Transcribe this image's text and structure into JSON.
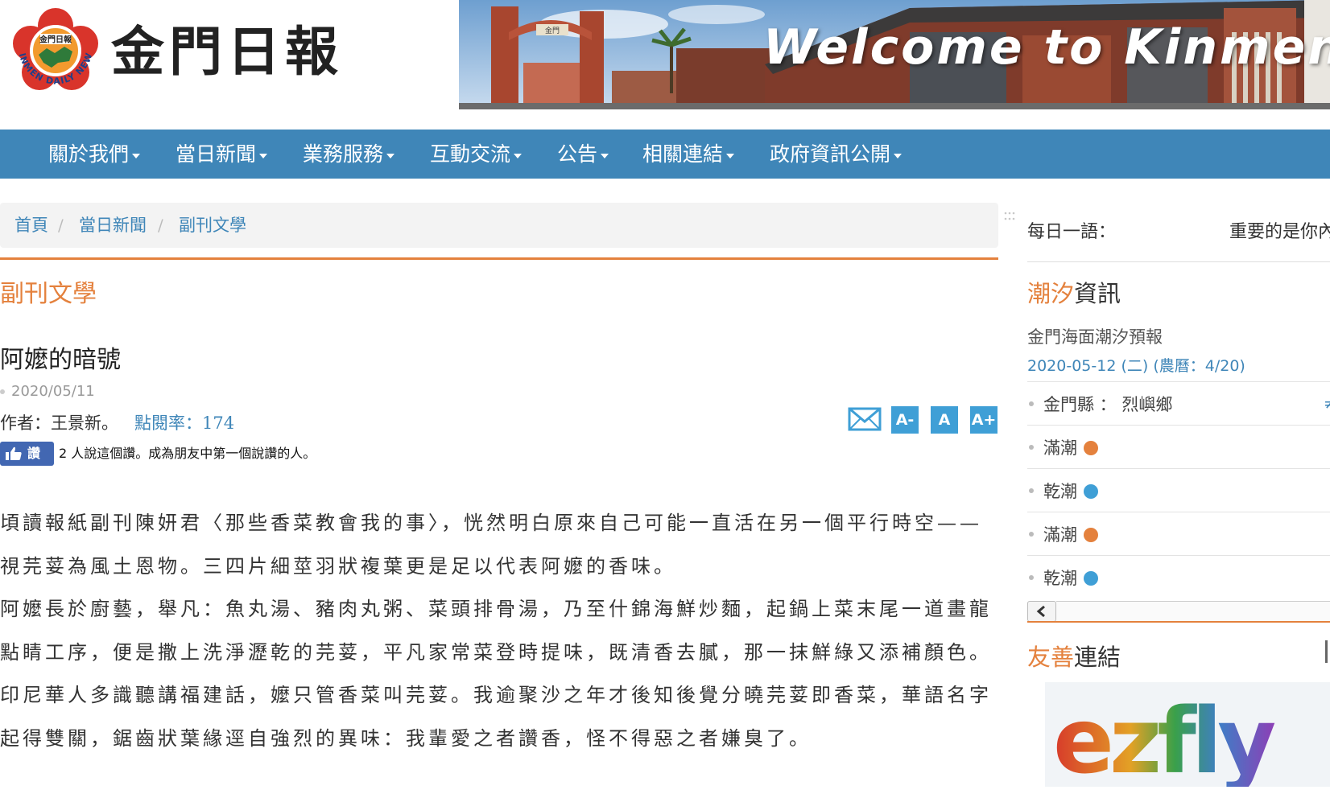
{
  "header": {
    "logo_title": "金門日報",
    "emblem_ring_text": "KINMEN DAILY NEWS",
    "emblem_center_text": "金門日報",
    "banner_text": "Welcome to Kinmen",
    "banner_gate_text": "金門"
  },
  "nav": {
    "items": [
      {
        "label": "關於我們"
      },
      {
        "label": "當日新聞"
      },
      {
        "label": "業務服務"
      },
      {
        "label": "互動交流"
      },
      {
        "label": "公告"
      },
      {
        "label": "相關連結"
      },
      {
        "label": "政府資訊公開"
      }
    ]
  },
  "breadcrumb": {
    "items": [
      {
        "label": "首頁"
      },
      {
        "label": "當日新聞"
      },
      {
        "label": "副刊文學"
      }
    ],
    "separator": "/"
  },
  "article": {
    "section": "副刊文學",
    "title": "阿嬤的暗號",
    "date": "2020/05/11",
    "author": "作者：王景新。",
    "views": "點閱率：174",
    "like_label": "讚",
    "like_text": "2 人說這個讚。成為朋友中第一個說讚的人。",
    "font_buttons": {
      "smaller": "A-",
      "normal": "A",
      "larger": "A+"
    },
    "paragraphs": [
      "頃讀報紙副刊陳妍君〈那些香菜教會我的事〉，恍然明白原來自己可能一直活在另一個平行時空——視芫荽為風土恩物。三四片細莖羽狀複葉更是足以代表阿嬤的香味。",
      "阿嬤長於廚藝，舉凡：魚丸湯、豬肉丸粥、菜頭排骨湯，乃至什錦海鮮炒麵，起鍋上菜末尾一道畫龍點睛工序，便是撒上洗淨瀝乾的芫荽，平凡家常菜登時提味，既清香去膩，那一抹鮮綠又添補顏色。",
      "印尼華人多識聽講福建話，嬤只管香菜叫芫荽。我逾聚沙之年才後知後覺分曉芫荽即香菜，華語名字起得雙關，鋸齒狀葉緣逕自強烈的異味：我輩愛之者讚香，怪不得惡之者嫌臭了。"
    ]
  },
  "sidebar": {
    "daily_label": "每日一語：",
    "daily_text": "重要的是你內",
    "tide": {
      "heading_highlight": "潮汐",
      "heading_rest": "資訊",
      "subtitle": "金門海面潮汐預報",
      "date": "2020-05-12 (二) (農曆：4/20)",
      "location": "金門縣 ： 烈嶼鄉",
      "location_extra": "≠",
      "rows": [
        {
          "label": "滿潮",
          "color": "#e4813d"
        },
        {
          "label": "乾潮",
          "color": "#3f9fd6"
        },
        {
          "label": "滿潮",
          "color": "#e4813d"
        },
        {
          "label": "乾潮",
          "color": "#3f9fd6"
        }
      ]
    },
    "links": {
      "heading_highlight": "友善",
      "heading_rest": "連結",
      "banner_text": "ezfly"
    }
  },
  "colors": {
    "nav_blue": "#3f86b8",
    "accent_orange": "#e4813d",
    "link_blue": "#3f86b8",
    "button_blue": "#3f9fd6"
  }
}
